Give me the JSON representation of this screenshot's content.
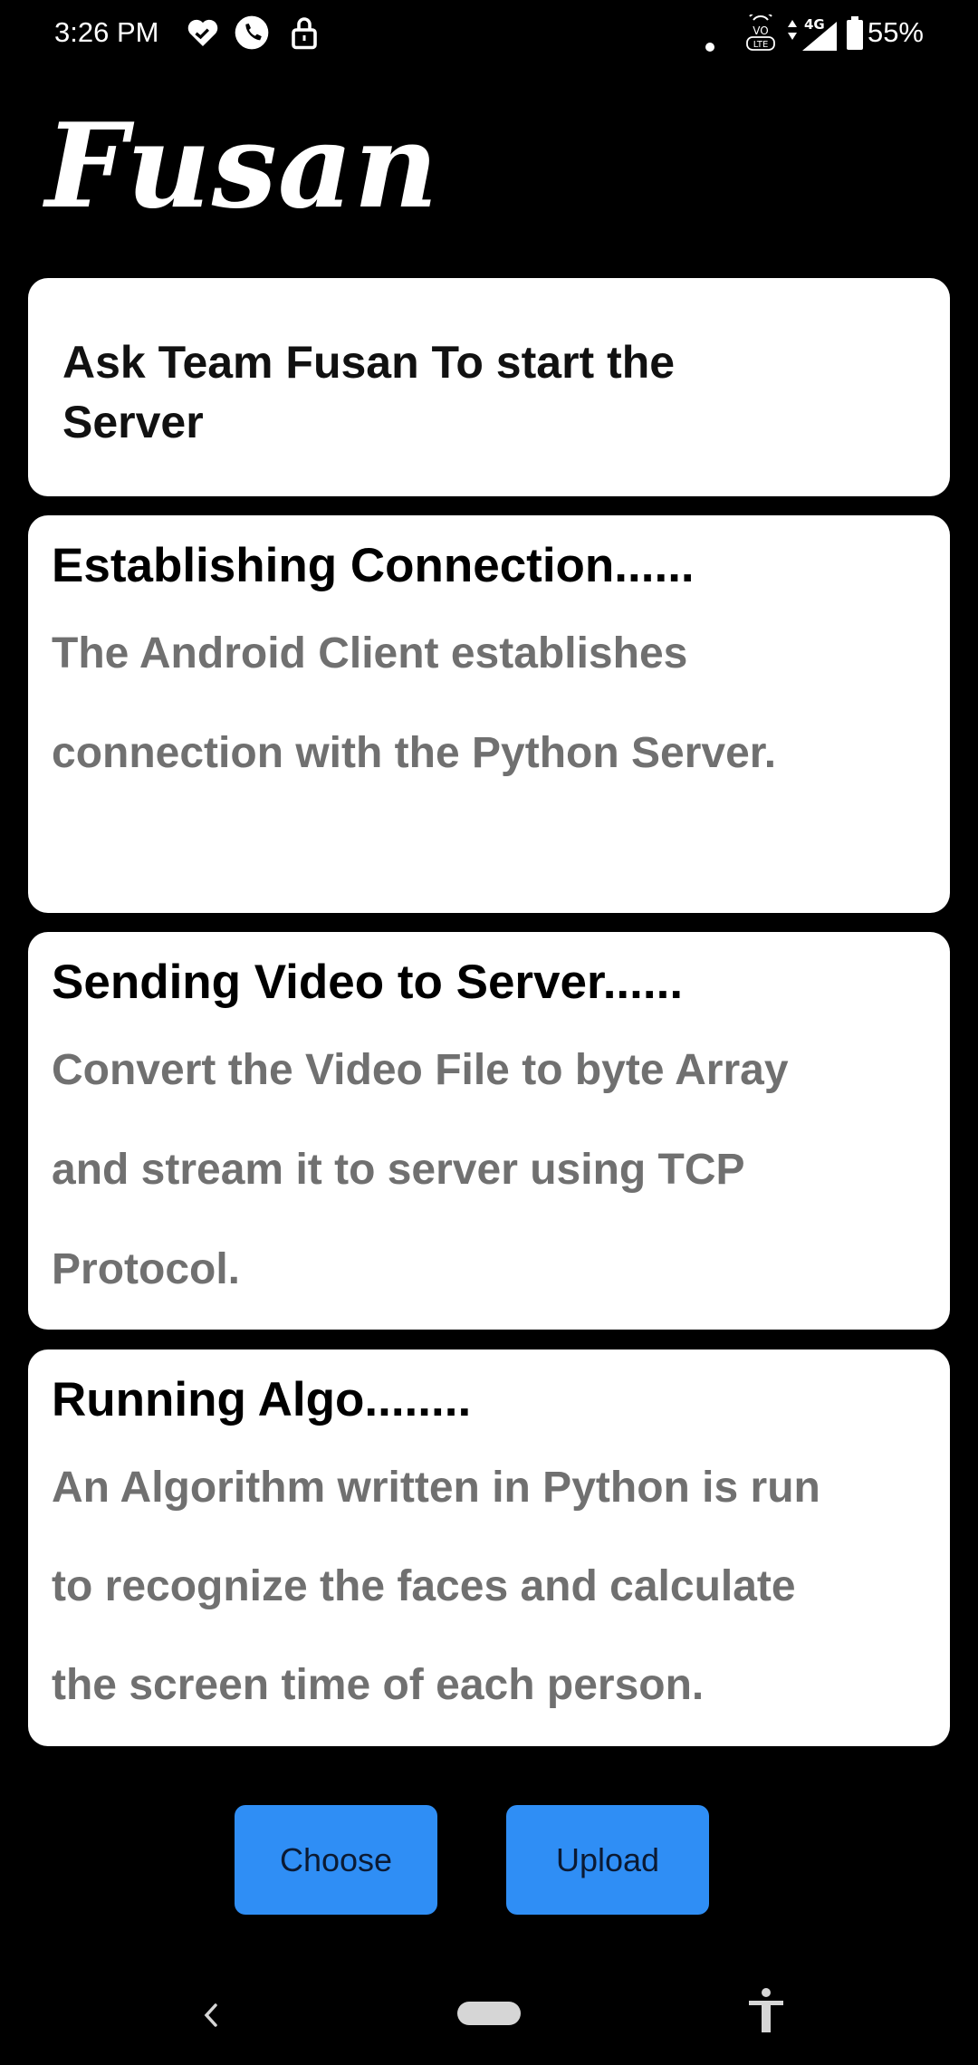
{
  "status_bar": {
    "time": "3:26 PM",
    "icons_left": [
      "heart-check-icon",
      "phone-icon",
      "lock-icon"
    ],
    "icons_right": [
      "dot-icon",
      "volte-icon",
      "signal-4g-icon",
      "battery-icon"
    ],
    "network": "4G",
    "volte": "VoLTE",
    "battery": "55%"
  },
  "app": {
    "logo": "Fusan"
  },
  "intro_card": {
    "text": "Ask Team Fusan To start the Server"
  },
  "steps": [
    {
      "title": "Establishing Connection......",
      "description": "The Android Client establishes connection with the Python Server."
    },
    {
      "title": "Sending Video to Server......",
      "description": "Convert the Video File to byte Array and stream it to server using TCP Protocol."
    },
    {
      "title": "Running Algo........",
      "description": "An Algorithm written in Python is run to recognize the faces and calculate the screen time of each person."
    }
  ],
  "buttons": {
    "choose": "Choose",
    "upload": "Upload"
  },
  "nav_bar": {
    "icons": [
      "back-icon",
      "home-pill-icon",
      "accessibility-icon"
    ]
  },
  "colors": {
    "background": "#000000",
    "card": "#ffffff",
    "button": "#2f8ef5",
    "description_text": "#707070"
  }
}
